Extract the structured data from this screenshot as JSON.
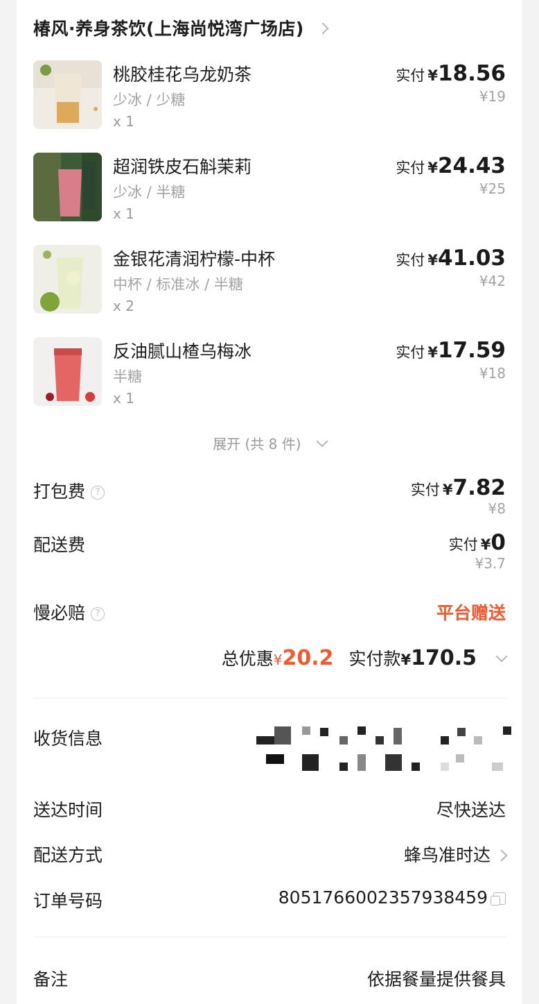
{
  "store": {
    "name": "椿风·养身茶饮(上海尚悦湾广场店)"
  },
  "items": [
    {
      "name": "桃胶桂花乌龙奶茶",
      "spec": "少冰 / 少糖",
      "qty": "x 1",
      "paid_label": "实付",
      "paid_amount": "18.56",
      "original": "¥19"
    },
    {
      "name": "超润铁皮石斛茉莉",
      "spec": "少冰 / 半糖",
      "qty": "x 1",
      "paid_label": "实付",
      "paid_amount": "24.43",
      "original": "¥25"
    },
    {
      "name": "金银花清润柠檬-中杯",
      "spec": "中杯 / 标准冰 / 半糖",
      "qty": "x 2",
      "paid_label": "实付",
      "paid_amount": "41.03",
      "original": "¥42"
    },
    {
      "name": "反油腻山楂乌梅冰",
      "spec": "半糖",
      "qty": "x 1",
      "paid_label": "实付",
      "paid_amount": "17.59",
      "original": "¥18"
    }
  ],
  "expand_label": "展开 (共 8 件)",
  "fees": {
    "packing": {
      "label": "打包费",
      "paid_label": "实付",
      "amount": "7.82",
      "original": "¥8"
    },
    "delivery": {
      "label": "配送费",
      "paid_label": "实付",
      "amount": "0",
      "original": "¥3.7"
    },
    "slow_compensation": {
      "label": "慢必赔",
      "value": "平台赠送"
    }
  },
  "totals": {
    "discount_label": "总优惠",
    "discount_amount": "20.2",
    "paid_label": "实付款",
    "paid_amount": "170.5"
  },
  "currency": "¥",
  "delivery_info": {
    "address_label": "收货信息",
    "time_label": "送达时间",
    "time_value": "尽快送达",
    "method_label": "配送方式",
    "method_value": "蜂鸟准时达",
    "order_label": "订单号码",
    "order_value": "8051766002357938459"
  },
  "remark": {
    "label": "备注",
    "value": "依据餐量提供餐具"
  },
  "colors": {
    "accent": "#ef5a30",
    "muted": "#a3a3a3"
  }
}
